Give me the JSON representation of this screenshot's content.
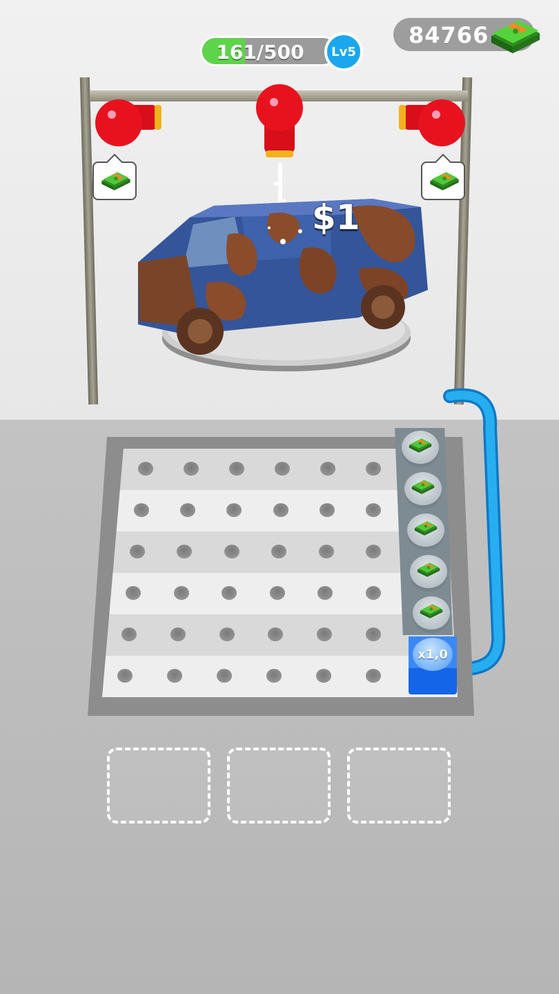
{
  "hud": {
    "progress_current": "161",
    "progress_sep_max": "/500",
    "progress_fraction": 0.322,
    "level": "Lv5",
    "money": "84766",
    "money_icon": "cash-stack-icon"
  },
  "scene": {
    "earn_popup": "$1",
    "station_tags": [
      "cash-icon",
      "cash-icon"
    ]
  },
  "board": {
    "rows": 6,
    "cols": 6,
    "conveyor_items": [
      "cash-icon",
      "cash-icon",
      "cash-icon",
      "cash-icon",
      "cash-icon"
    ],
    "multiplier": "x1,0"
  },
  "slots": [
    "empty",
    "empty",
    "empty"
  ],
  "colors": {
    "progress_fill": "#5ed44a",
    "level_badge": "#1aa7ee",
    "nozzle_red": "#e8121f",
    "hose_blue": "#1a9ae4",
    "multiplier_block": "#1565e8"
  }
}
